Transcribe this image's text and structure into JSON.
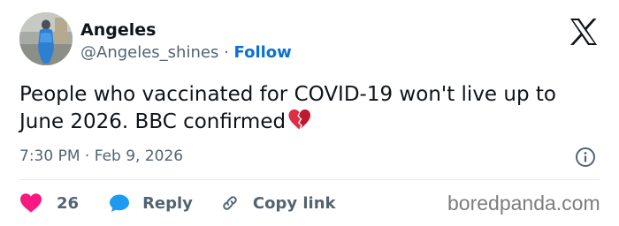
{
  "author": {
    "name": "Angeles",
    "handle": "@Angeles_shines",
    "separator": "·",
    "follow_label": "Follow"
  },
  "tweet": {
    "text": "People who vaccinated for COVID-19 won't live up to June 2026. BBC confirmed",
    "emoji": "broken-heart",
    "time": "7:30 PM",
    "date_separator": "·",
    "date": "Feb 9, 2026"
  },
  "actions": {
    "like_count": "26",
    "reply_label": "Reply",
    "copy_label": "Copy link"
  },
  "watermark": "boredpanda.com",
  "icons": {
    "logo": "x-logo-icon",
    "info": "info-icon",
    "like": "heart-icon",
    "reply": "speech-bubble-icon",
    "copy": "link-icon"
  },
  "colors": {
    "text": "#0f1419",
    "secondary": "#536471",
    "follow": "#0b6fd6",
    "like": "#f91880",
    "reply": "#1d9bf0",
    "emoji": "#dd2e44"
  }
}
